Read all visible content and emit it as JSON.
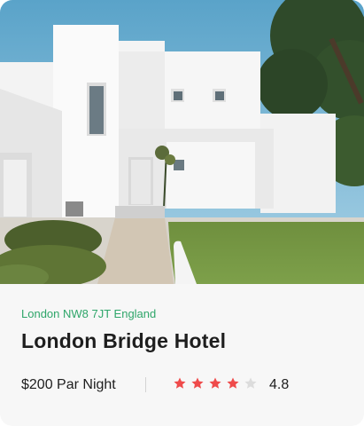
{
  "hotel": {
    "location": "London NW8 7JT England",
    "name": "London Bridge Hotel",
    "price": "$200 Par Night",
    "rating": "4.8",
    "stars_filled": 4,
    "stars_total": 5
  },
  "colors": {
    "location": "#2fa66a",
    "star_filled": "#ef4b4b",
    "star_empty": "#dcdcdc"
  },
  "icons": {
    "star": "star-icon"
  }
}
